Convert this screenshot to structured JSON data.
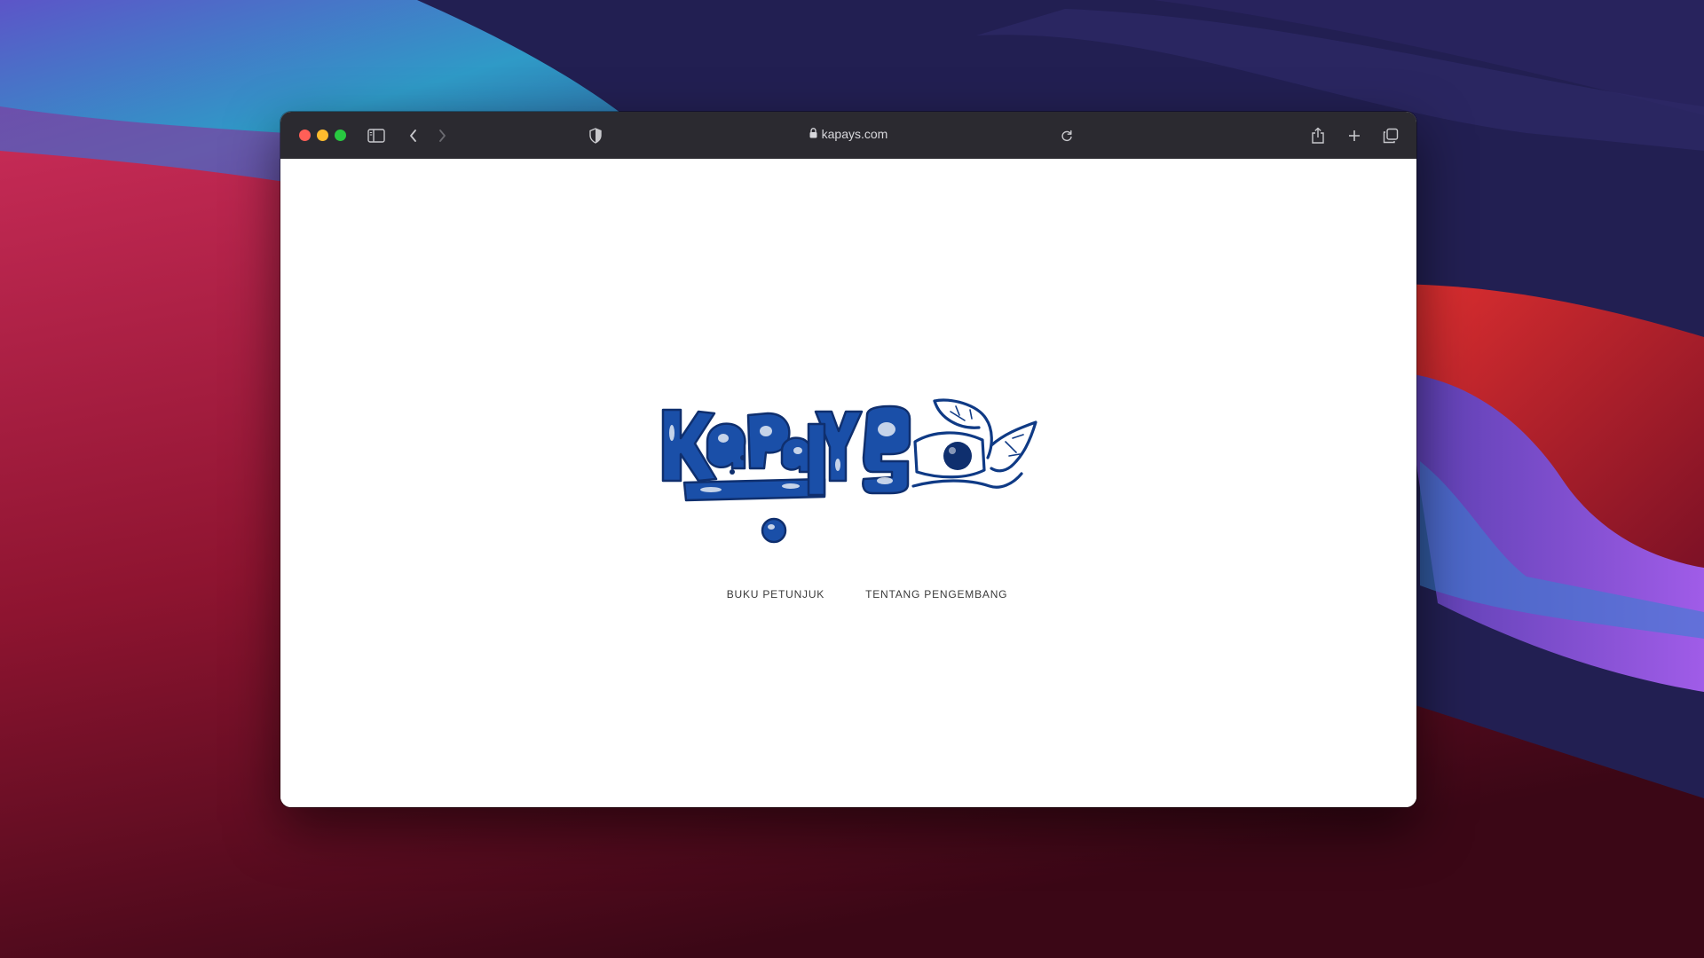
{
  "browser": {
    "url": "kapays.com",
    "icons": {
      "sidebar": "sidebar-icon",
      "back": "chevron-left-icon",
      "forward": "chevron-right-icon",
      "privacy": "shield-icon",
      "lock": "lock-icon",
      "reload": "reload-icon",
      "share": "share-icon",
      "new_tab": "plus-icon",
      "tabs": "tabs-overview-icon"
    }
  },
  "page": {
    "logo_text": "Kapays",
    "logo_color": "#1a4fa8",
    "nav": [
      {
        "label": "BUKU PETUNJUK"
      },
      {
        "label": "TENTANG PENGEMBANG"
      }
    ]
  },
  "colors": {
    "toolbar": "#2b2a30",
    "traffic_close": "#ff5f57",
    "traffic_minimize": "#febc2e",
    "traffic_zoom": "#28c840"
  }
}
